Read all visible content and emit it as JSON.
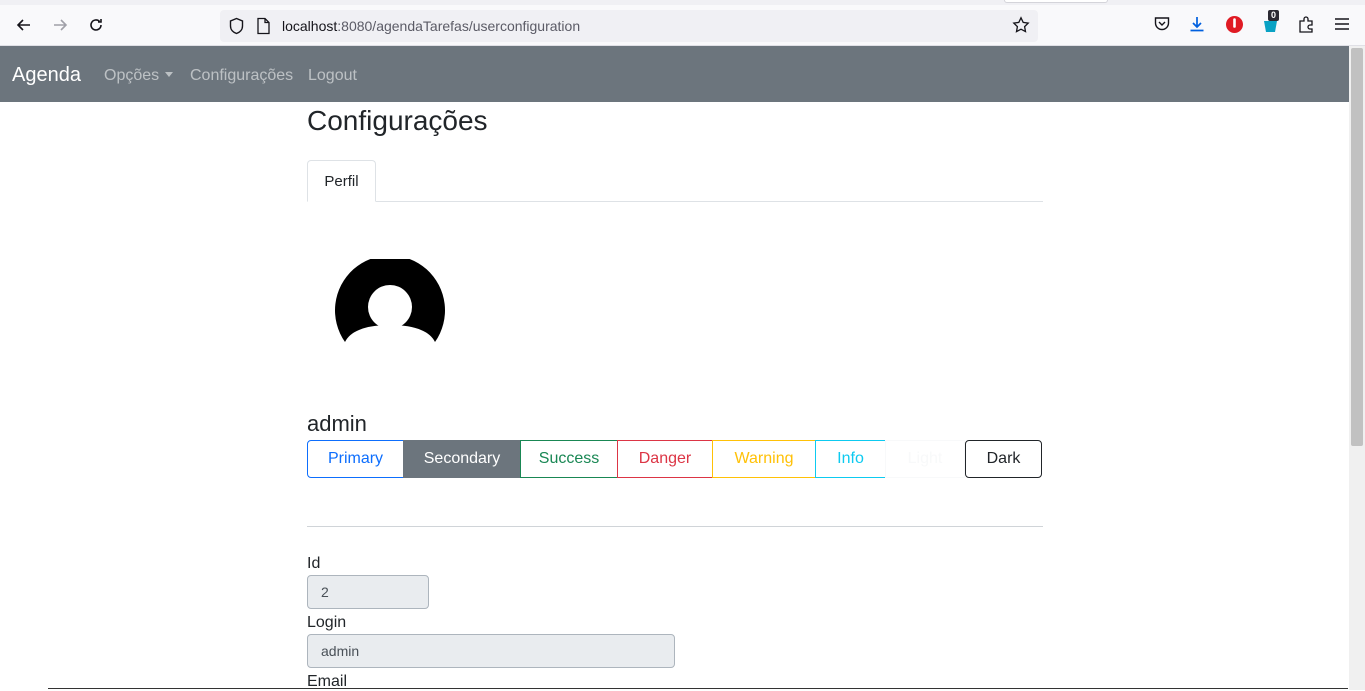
{
  "browser": {
    "url_host": "localhost",
    "url_rest": ":8080/agendaTarefas/userconfiguration",
    "badge_count": "0"
  },
  "navbar": {
    "brand": "Agenda",
    "items": [
      {
        "label": "Opções"
      },
      {
        "label": "Configurações"
      },
      {
        "label": "Logout"
      }
    ]
  },
  "page": {
    "title": "Configurações",
    "tabs": [
      {
        "label": "Perfil"
      }
    ],
    "username": "admin"
  },
  "theme_buttons": [
    {
      "label": "Primary",
      "color": "#0d6efd"
    },
    {
      "label": "Secondary",
      "color": "#6c757d"
    },
    {
      "label": "Success",
      "color": "#198754"
    },
    {
      "label": "Danger",
      "color": "#dc3545"
    },
    {
      "label": "Warning",
      "color": "#ffc107"
    },
    {
      "label": "Info",
      "color": "#0dcaf0"
    },
    {
      "label": "Light",
      "color": "#f8f9fa"
    },
    {
      "label": "Dark",
      "color": "#212529"
    }
  ],
  "form": {
    "id_label": "Id",
    "id_value": "2",
    "login_label": "Login",
    "login_value": "admin",
    "email_label": "Email"
  }
}
